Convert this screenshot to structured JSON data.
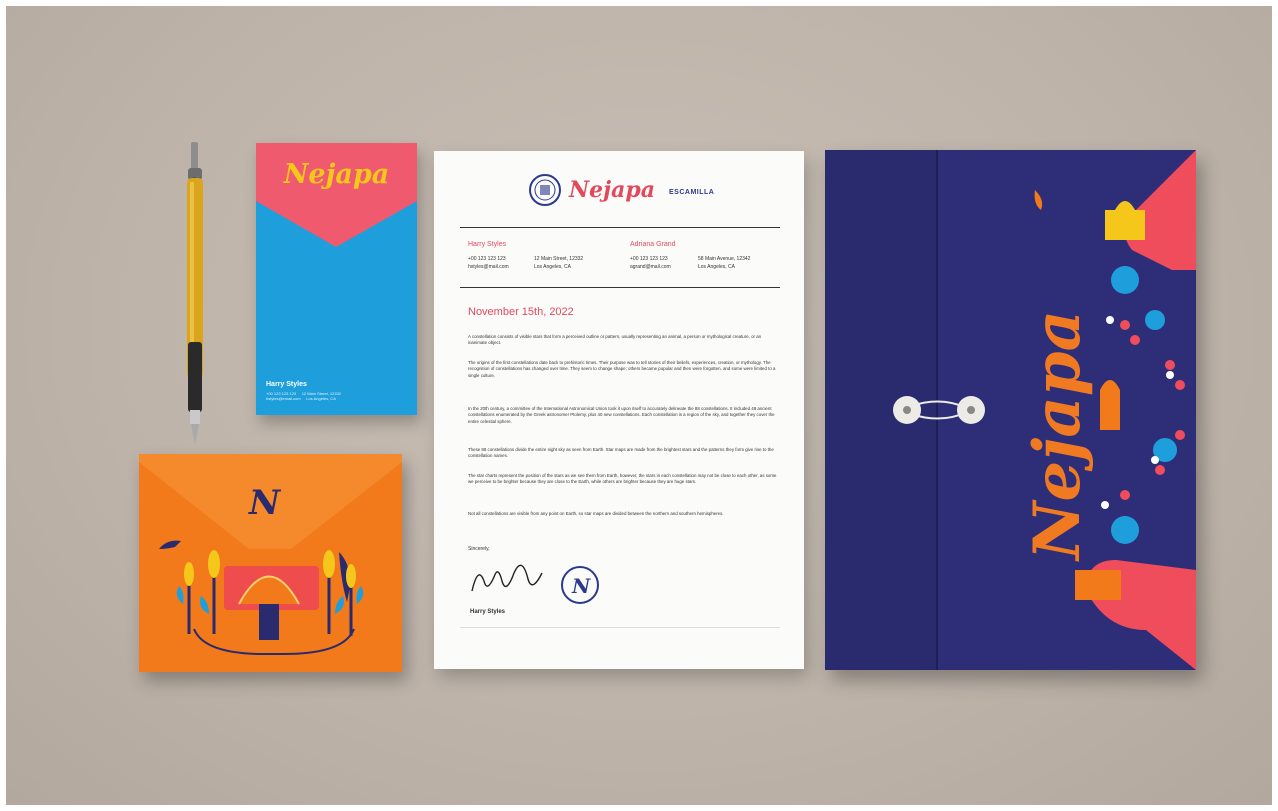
{
  "brand": {
    "name": "Nejapa",
    "partner": "ESCAMILLA"
  },
  "business_card": {
    "name": "Harry Styles",
    "contact": "+00 123 123 123     12 Main Street, 12332\nhstyles@email.com     Los Angeles, CA"
  },
  "letterhead": {
    "contacts": [
      {
        "name": "Harry Styles",
        "phone": "+00 123 123 123",
        "email": "hstyles@mail.com",
        "address1": "12 Main Street, 12332",
        "address2": "Los Angeles, CA"
      },
      {
        "name": "Adriana Grand",
        "phone": "+00 123 123 123",
        "email": "agrand@mail.com",
        "address1": "58 Main Avenue, 12342",
        "address2": "Los Angeles, CA"
      }
    ],
    "date": "November 15th, 2022",
    "paragraphs": [
      "A constellation consists of visible stars that form a perceived outline or pattern, usually representing an animal, a person or mythological creature, or an inanimate object.",
      "The origins of the first constellations date back to prehistoric times. Their purpose was to tell stories of their beliefs, experiences, creation, or mythology. The recognition of constellations has changed over time. They seem to change shape; others became popular and then were forgotten, and some were limited to a single culture.",
      "In the 20th century, a committee of the International Astronomical Union took it upon itself to accurately delineate the 88 constellations. It included 48 ancient constellations enumerated by the Greek astronomer Ptolemy, plus 40 new constellations. Each constellation is a region of the sky, and together they cover the entire celestial sphere.",
      "These 88 constellations divide the entire night sky as seen from Earth. Star maps are made from the brightest stars and the patterns they form give rise to the constellation names.",
      "The star charts represent the position of the stars as we see them from Earth, however, the stars in each constellation may not be close to each other, as some we perceive to be brighter because they are close to the Earth, while others are brighter because they are huge stars.",
      "Not all constellations are visible from any point on Earth, so star maps are divided between the northern and southern hemispheres."
    ],
    "closing": "Sincerely,",
    "signer": "Harry Styles"
  },
  "colors": {
    "background": "#bdb3a9",
    "coral": "#e2495c",
    "blue": "#1e9fdc",
    "orange": "#f27a1a",
    "navy": "#2a2a6f",
    "yellow": "#f5c71a"
  }
}
